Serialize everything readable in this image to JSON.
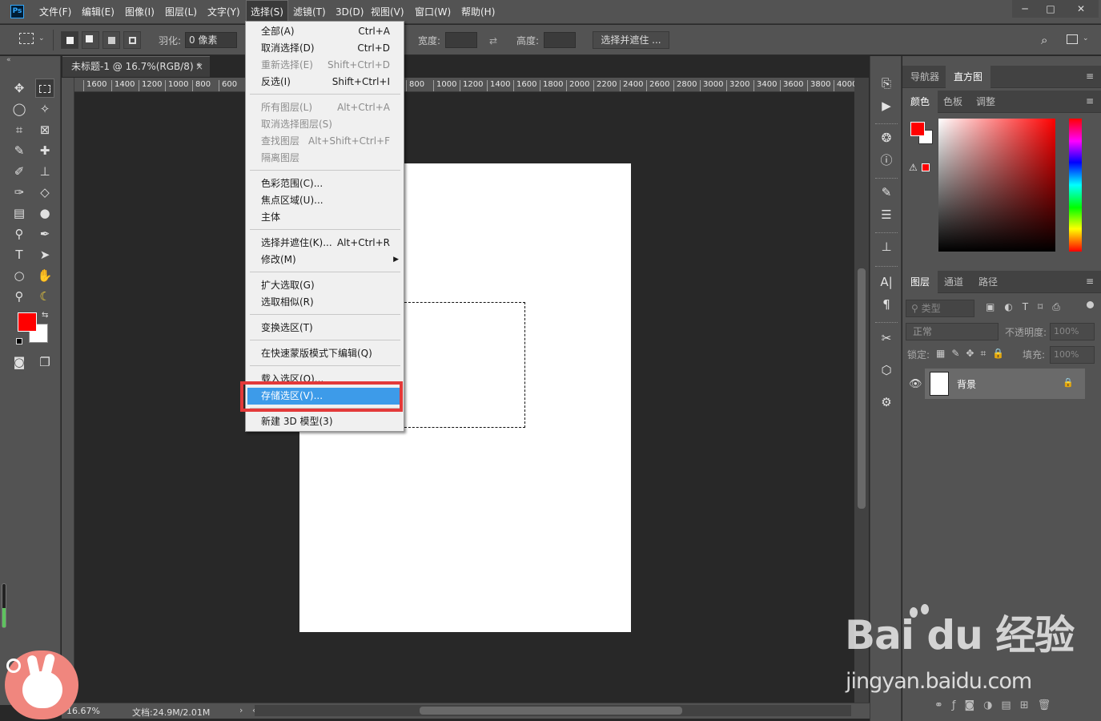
{
  "app": {
    "logo": "Ps"
  },
  "menubar": {
    "items": [
      "文件(F)",
      "编辑(E)",
      "图像(I)",
      "图层(L)",
      "文字(Y)",
      "选择(S)",
      "滤镜(T)",
      "3D(D)",
      "视图(V)",
      "窗口(W)",
      "帮助(H)"
    ],
    "active": "选择(S)"
  },
  "window_controls": {
    "minimize": "─",
    "restore": "□",
    "close": "✕"
  },
  "options_bar": {
    "feather_label": "羽化:",
    "feather_value": "0 像素",
    "width_label": "宽度:",
    "height_label": "高度:",
    "select_mask_button": "选择并遮住 ..."
  },
  "document": {
    "tab_title": "未标题-1 @ 16.7%(RGB/8) *",
    "tab_close": "×",
    "zoom": "16.67%",
    "doc_info": "文档:24.9M/2.01M",
    "ruler_left": [
      "1600",
      "1400",
      "1200",
      "1000",
      "800",
      "600"
    ],
    "ruler_right": [
      "800",
      "1000",
      "1200",
      "1400",
      "1600",
      "1800",
      "2000",
      "2200",
      "2400",
      "2600",
      "2800",
      "3000",
      "3200",
      "3400",
      "3600",
      "3800",
      "4000"
    ]
  },
  "dropdown": {
    "groups": [
      [
        {
          "label": "全部(A)",
          "shortcut": "Ctrl+A",
          "disabled": false
        },
        {
          "label": "取消选择(D)",
          "shortcut": "Ctrl+D",
          "disabled": false
        },
        {
          "label": "重新选择(E)",
          "shortcut": "Shift+Ctrl+D",
          "disabled": true
        },
        {
          "label": "反选(I)",
          "shortcut": "Shift+Ctrl+I",
          "disabled": false
        }
      ],
      [
        {
          "label": "所有图层(L)",
          "shortcut": "Alt+Ctrl+A",
          "disabled": true
        },
        {
          "label": "取消选择图层(S)",
          "shortcut": "",
          "disabled": true
        },
        {
          "label": "查找图层",
          "shortcut": "Alt+Shift+Ctrl+F",
          "disabled": true
        },
        {
          "label": "隔离图层",
          "shortcut": "",
          "disabled": true
        }
      ],
      [
        {
          "label": "色彩范围(C)...",
          "shortcut": "",
          "disabled": false
        },
        {
          "label": "焦点区域(U)...",
          "shortcut": "",
          "disabled": false
        },
        {
          "label": "主体",
          "shortcut": "",
          "disabled": false
        }
      ],
      [
        {
          "label": "选择并遮住(K)...",
          "shortcut": "Alt+Ctrl+R",
          "disabled": false
        },
        {
          "label": "修改(M)",
          "shortcut": "▶",
          "disabled": false
        }
      ],
      [
        {
          "label": "扩大选取(G)",
          "shortcut": "",
          "disabled": false
        },
        {
          "label": "选取相似(R)",
          "shortcut": "",
          "disabled": false
        }
      ],
      [
        {
          "label": "变换选区(T)",
          "shortcut": "",
          "disabled": false
        }
      ],
      [
        {
          "label": "在快速蒙版模式下编辑(Q)",
          "shortcut": "",
          "disabled": false
        }
      ],
      [
        {
          "label": "载入选区(O)...",
          "shortcut": "",
          "disabled": false
        },
        {
          "label": "存储选区(V)...",
          "shortcut": "",
          "disabled": false,
          "highlighted": true
        }
      ],
      [
        {
          "label": "新建 3D 模型(3)",
          "shortcut": "",
          "disabled": false
        }
      ]
    ]
  },
  "panels": {
    "top_tabs": [
      "导航器",
      "直方图"
    ],
    "top_active": "直方图",
    "color_tabs": [
      "颜色",
      "色板",
      "调整"
    ],
    "color_active": "颜色",
    "layer_tabs": [
      "图层",
      "通道",
      "路径"
    ],
    "layer_active": "图层",
    "filter_label": "类型",
    "blend_mode": "正常",
    "opacity_label": "不透明度:",
    "opacity_value": "100%",
    "lock_label": "锁定:",
    "fill_label": "填充:",
    "fill_value": "100%",
    "layer_name": "背景",
    "foreground_color": "#ff0000",
    "background_color": "#ffffff"
  },
  "watermark": {
    "brand": "Bai du 经验",
    "url": "jingyan.baidu.com"
  }
}
